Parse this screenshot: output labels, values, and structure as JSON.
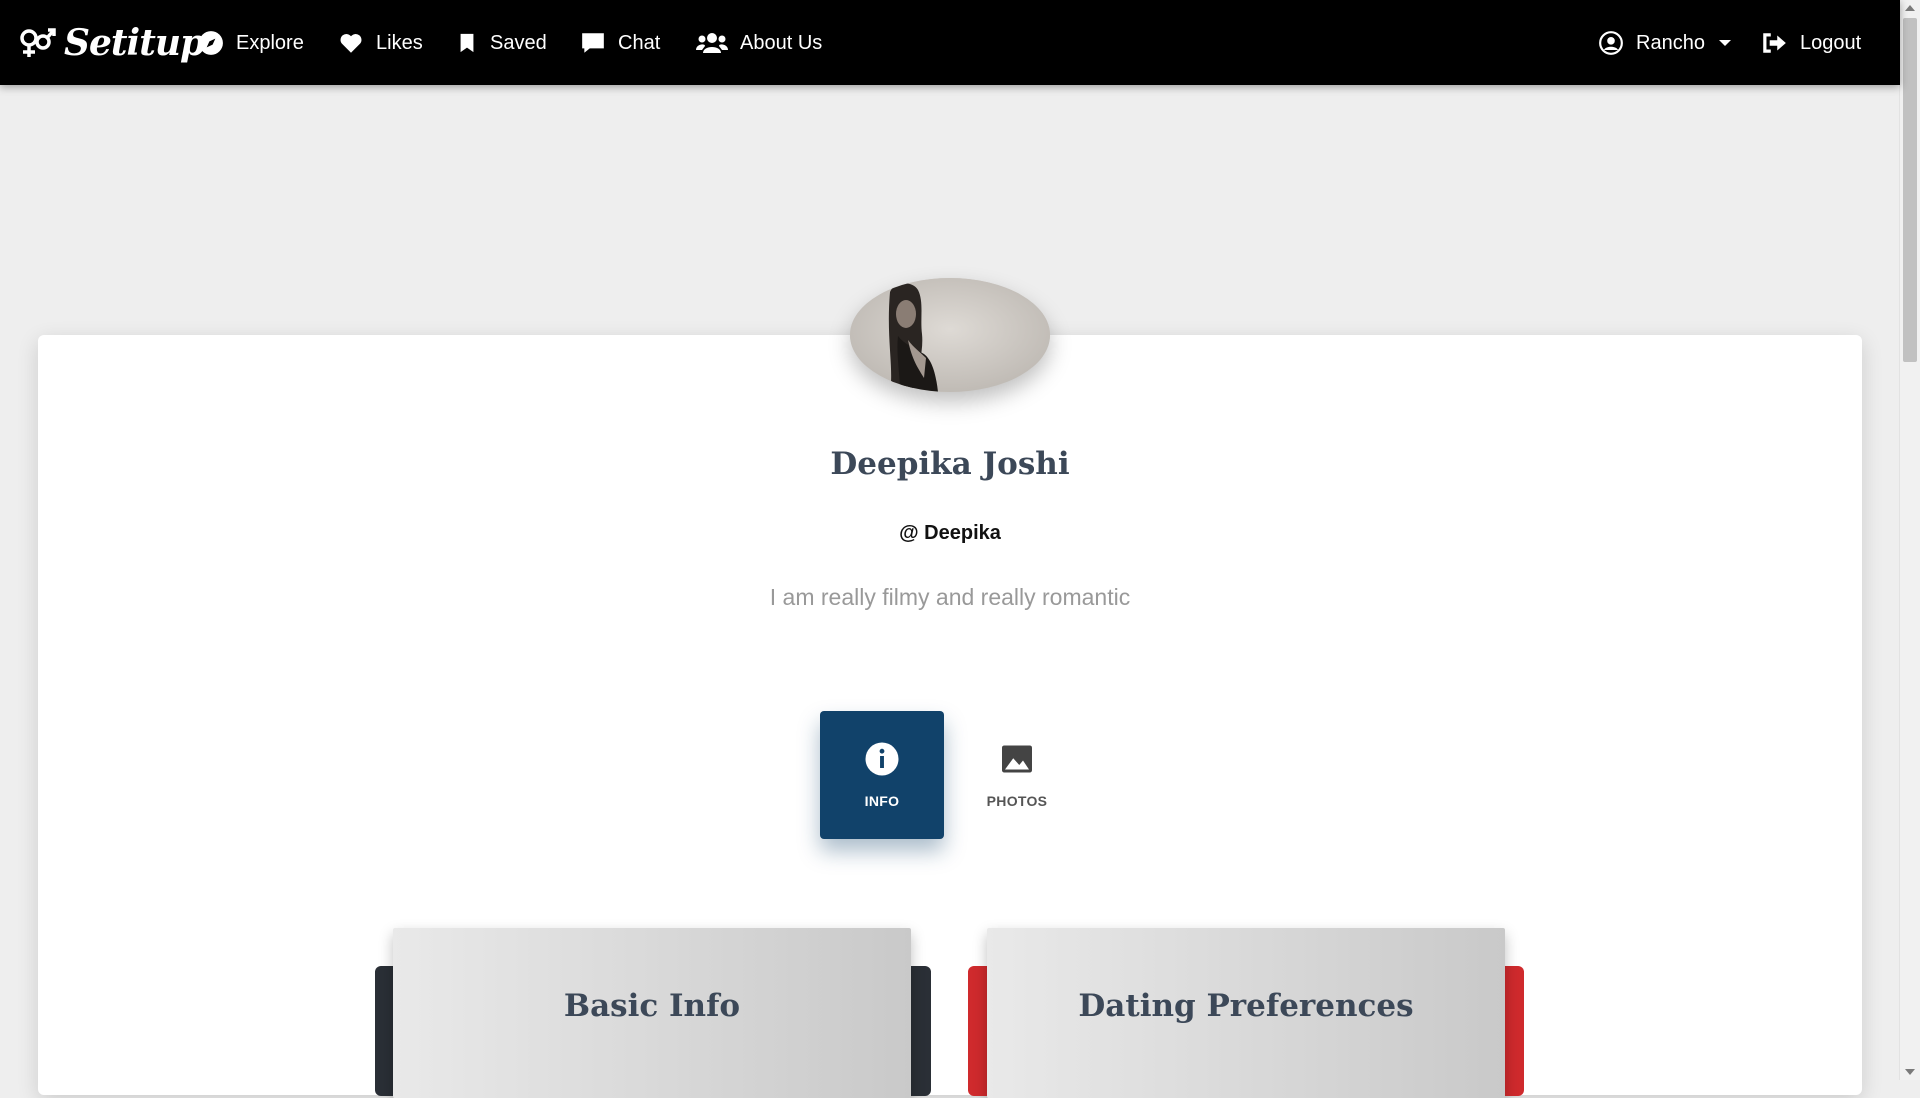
{
  "navbar": {
    "brand": "Setitup",
    "items": [
      {
        "label": "Explore",
        "icon": "compass-icon"
      },
      {
        "label": "Likes",
        "icon": "heart-icon"
      },
      {
        "label": "Saved",
        "icon": "bookmark-icon"
      },
      {
        "label": "Chat",
        "icon": "chat-icon"
      },
      {
        "label": "About Us",
        "icon": "users-icon"
      }
    ],
    "user": {
      "label": "Rancho",
      "icon": "user-circle-icon"
    },
    "logout": {
      "label": "Logout",
      "icon": "logout-icon"
    }
  },
  "profile": {
    "name": "Deepika Joshi",
    "username": "@ Deepika",
    "bio": "I am really filmy and really romantic"
  },
  "tabs": [
    {
      "label": "INFO",
      "icon": "info-icon",
      "active": true
    },
    {
      "label": "PHOTOS",
      "icon": "image-icon",
      "active": false
    }
  ],
  "sections": {
    "basic": "Basic Info",
    "dating": "Dating Preferences"
  },
  "colors": {
    "navbar": "#000000",
    "tab_active": "#11426a",
    "accent_dark": "#2a2f36",
    "accent_red": "#cf2a2d"
  }
}
